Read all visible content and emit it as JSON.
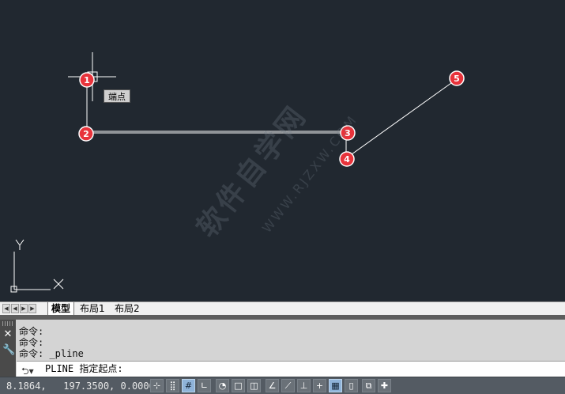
{
  "canvas": {
    "tooltip": "端点",
    "ucs_x_label": "X",
    "ucs_y_label": "Y",
    "markers": [
      "1",
      "2",
      "3",
      "4",
      "5"
    ],
    "watermark_text": "软件自学网",
    "watermark_url": "WWW.RJZXW.COM"
  },
  "layout_tabs": {
    "nav_buttons": [
      "|◀",
      "◀",
      "▶",
      "▶|"
    ],
    "tabs": [
      "模型",
      "布局1",
      "布局2"
    ],
    "active": "模型"
  },
  "command": {
    "history": [
      "命令:",
      "命令:",
      "命令: _pline"
    ],
    "prompt": "PLINE 指定起点:"
  },
  "status": {
    "coordinates": "8.1864,   197.3500, 0.0000",
    "buttons": [
      "snap-to-point",
      "snap",
      "grid",
      "ortho",
      "polar",
      "object-snap",
      "3d-object-snap",
      "otrack",
      "ducs",
      "dynamic-input",
      "lineweight",
      "transparency",
      "quick-properties",
      "selection-cycling",
      "annotation-monitor"
    ]
  },
  "colors": {
    "canvas_bg": "#212830",
    "marker_red": "#e8333b",
    "line_white": "#ffffff"
  }
}
